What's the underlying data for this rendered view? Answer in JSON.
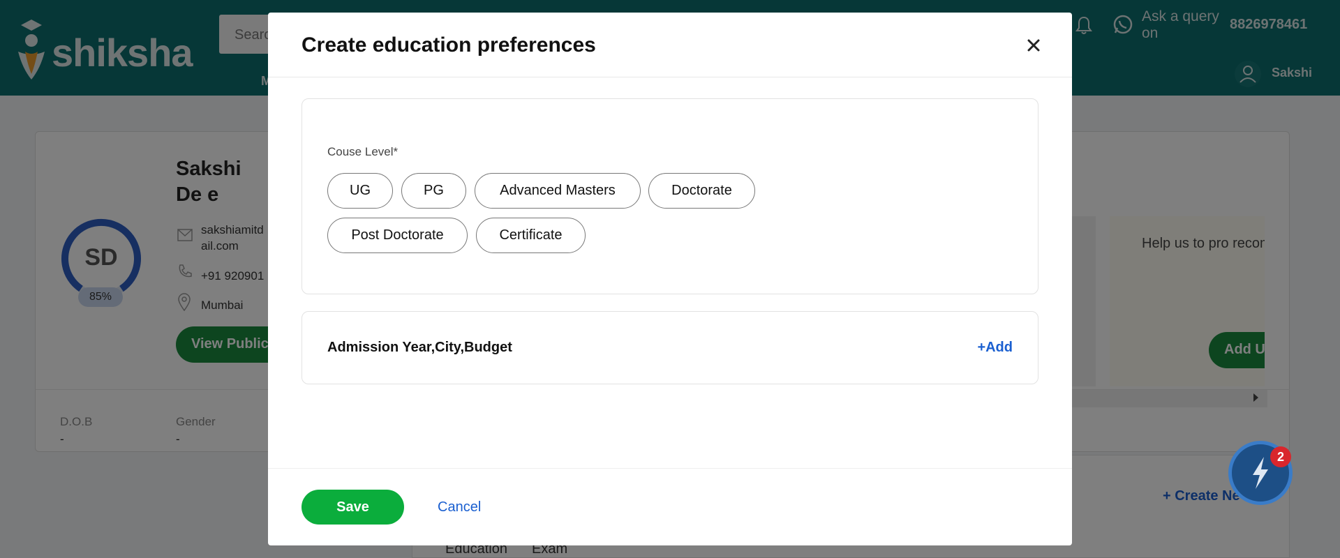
{
  "header": {
    "logo_text": "shiksha",
    "search_placeholder": "Search",
    "nav_partial": "M",
    "query_text": "Ask a query on",
    "phone": "8826978461",
    "user_name": "Sakshi"
  },
  "profile": {
    "name": "Sakshi De e",
    "initials": "SD",
    "completion": "85%",
    "email": "sakshiamitd ail.com",
    "phone": "+91 920901",
    "city": "Mumbai",
    "view_button": "View Public",
    "dob_label": "D.O.B",
    "dob_value": "-",
    "gender_label": "Gender",
    "gender_value": "-",
    "help_text": "Help us to pro recommendatio Graduati",
    "add_button": "Add U",
    "create_new": "+ Create Ne",
    "tab_education": "Education",
    "tab_exam": "Exam"
  },
  "chat": {
    "badge_count": "2"
  },
  "modal": {
    "title": "Create education preferences",
    "course_level_label": "Couse Level*",
    "course_levels": [
      "UG",
      "PG",
      "Advanced Masters",
      "Doctorate",
      "Post Doctorate",
      "Certificate"
    ],
    "admission_label": "Admission Year,City,Budget",
    "add_label": "+Add",
    "save_label": "Save",
    "cancel_label": "Cancel"
  },
  "colors": {
    "header_teal": "#0d6e6e",
    "save_green": "#0bad3c",
    "link_blue": "#1a5fd0"
  }
}
